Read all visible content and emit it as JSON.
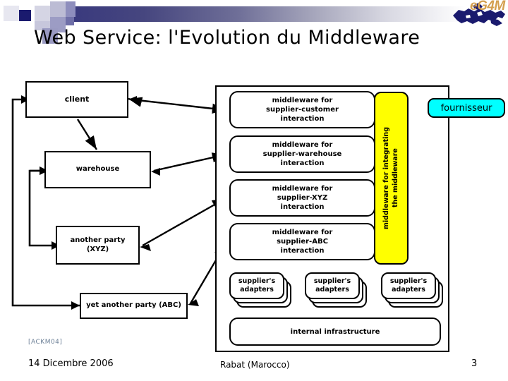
{
  "header": {
    "logo_text": "eG4M",
    "logo_icon": "mediterranean-map-icon",
    "title": "Web Service: l'Evolution du Middleware",
    "accent_dark": "#3a3a7e",
    "accent_logo": "#d4a050"
  },
  "diagram": {
    "left_entities": [
      {
        "id": "client",
        "label": "client"
      },
      {
        "id": "warehouse",
        "label": "warehouse"
      },
      {
        "id": "another-party",
        "label": "another party\n(XYZ)"
      },
      {
        "id": "yet-another-party",
        "label": "yet another party (ABC)"
      }
    ],
    "middleware_boxes": [
      {
        "id": "mw-supplier-customer",
        "label": "middleware for\nsupplier-customer\ninteraction"
      },
      {
        "id": "mw-supplier-warehouse",
        "label": "middleware for\nsupplier-warehouse\ninteraction"
      },
      {
        "id": "mw-supplier-xyz",
        "label": "middleware for\nsupplier-XYZ\ninteraction"
      },
      {
        "id": "mw-supplier-abc",
        "label": "middleware for\nsupplier-ABC\ninteraction"
      }
    ],
    "integrating_middleware": {
      "label": "middleware for integrating\nthe middleware",
      "color": "#ffff00"
    },
    "adapters": [
      {
        "id": "adapters-1",
        "label": "supplier's\nadapters"
      },
      {
        "id": "adapters-2",
        "label": "supplier's\nadapters"
      },
      {
        "id": "adapters-3",
        "label": "supplier's\nadapters"
      }
    ],
    "internal_infrastructure": {
      "label": "internal infrastructure"
    },
    "callout": {
      "label": "fournisseur",
      "color": "#00ffff"
    }
  },
  "footer": {
    "citation": "[ACKM04]",
    "date": "14 Dicembre 2006",
    "place": "Rabat (Marocco)",
    "page_number": "3"
  }
}
